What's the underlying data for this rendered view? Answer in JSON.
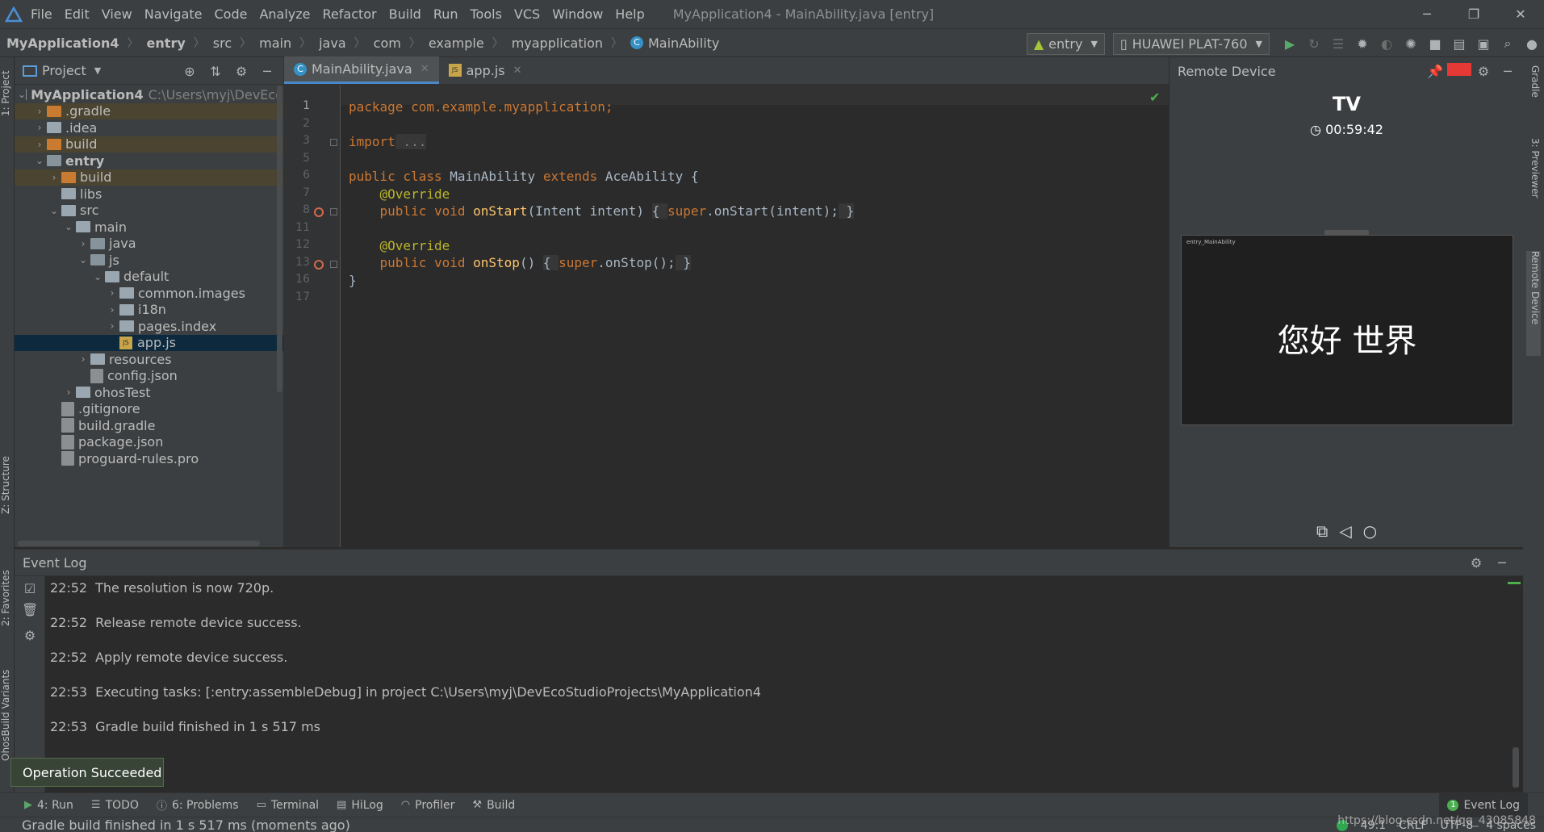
{
  "menubar": {
    "items": [
      "File",
      "Edit",
      "View",
      "Navigate",
      "Code",
      "Analyze",
      "Refactor",
      "Build",
      "Run",
      "Tools",
      "VCS",
      "Window",
      "Help"
    ],
    "window_title": "MyApplication4 - MainAbility.java [entry]"
  },
  "navbar": {
    "crumbs": [
      "MyApplication4",
      "entry",
      "src",
      "main",
      "java",
      "com",
      "example",
      "myapplication",
      "MainAbility"
    ],
    "run_config": "entry",
    "device": "HUAWEI PLAT-760"
  },
  "project": {
    "title": "Project",
    "root_path": "C:\\Users\\myj\\DevEco",
    "tree": [
      {
        "label": "MyApplication4",
        "depth": 0,
        "open": true,
        "kind": "module",
        "bold": true
      },
      {
        "label": ".gradle",
        "depth": 1,
        "open": false,
        "kind": "orange",
        "excluded": true
      },
      {
        "label": ".idea",
        "depth": 1,
        "open": false,
        "kind": "grey"
      },
      {
        "label": "build",
        "depth": 1,
        "open": false,
        "kind": "orange",
        "excluded": true
      },
      {
        "label": "entry",
        "depth": 1,
        "open": true,
        "kind": "module",
        "bold": true
      },
      {
        "label": "build",
        "depth": 2,
        "open": false,
        "kind": "orange",
        "excluded": true
      },
      {
        "label": "libs",
        "depth": 2,
        "open": null,
        "kind": "grey"
      },
      {
        "label": "src",
        "depth": 2,
        "open": true,
        "kind": "grey"
      },
      {
        "label": "main",
        "depth": 3,
        "open": true,
        "kind": "grey"
      },
      {
        "label": "java",
        "depth": 4,
        "open": false,
        "kind": "blue"
      },
      {
        "label": "js",
        "depth": 4,
        "open": true,
        "kind": "blue"
      },
      {
        "label": "default",
        "depth": 5,
        "open": true,
        "kind": "grey"
      },
      {
        "label": "common.images",
        "depth": 6,
        "open": false,
        "kind": "grey"
      },
      {
        "label": "i18n",
        "depth": 6,
        "open": false,
        "kind": "grey"
      },
      {
        "label": "pages.index",
        "depth": 6,
        "open": false,
        "kind": "grey"
      },
      {
        "label": "app.js",
        "depth": 6,
        "open": null,
        "kind": "js",
        "selected": true
      },
      {
        "label": "resources",
        "depth": 4,
        "open": false,
        "kind": "grey"
      },
      {
        "label": "config.json",
        "depth": 4,
        "open": null,
        "kind": "file"
      },
      {
        "label": "ohosTest",
        "depth": 3,
        "open": false,
        "kind": "grey"
      },
      {
        "label": ".gitignore",
        "depth": 2,
        "open": null,
        "kind": "file"
      },
      {
        "label": "build.gradle",
        "depth": 2,
        "open": null,
        "kind": "file"
      },
      {
        "label": "package.json",
        "depth": 2,
        "open": null,
        "kind": "file"
      },
      {
        "label": "proguard-rules.pro",
        "depth": 2,
        "open": null,
        "kind": "file"
      }
    ]
  },
  "editor": {
    "tabs": [
      {
        "label": "MainAbility.java",
        "active": true
      },
      {
        "label": "app.js",
        "active": false
      }
    ],
    "line_numbers": [
      "1",
      "2",
      "3",
      "5",
      "6",
      "7",
      "8",
      "11",
      "12",
      "13",
      "16",
      "17"
    ],
    "code": {
      "l1_kw": "package",
      "l1_rest": " com.example.myapplication;",
      "l3_kw": "import",
      "l3_rest": " ...",
      "l6_kw1": "public class",
      "l6_name": " MainAbility ",
      "l6_kw2": "extends",
      "l6_rest": " AceAbility {",
      "l7_ann": "    @Override",
      "l8_kw": "    public void",
      "l8_fn": " onStart",
      "l8_args": "(Intent intent) ",
      "l8_body_open": "{ ",
      "l8_super": "super",
      "l8_call": ".onStart(intent);",
      "l8_body_close": " }",
      "l12_ann": "    @Override",
      "l13_kw": "    public void",
      "l13_fn": " onStop",
      "l13_args": "() ",
      "l13_body_open": "{ ",
      "l13_super": "super",
      "l13_call": ".onStop();",
      "l13_body_close": " }",
      "l16": "}"
    }
  },
  "remote": {
    "title": "Remote Device",
    "device_name": "TV",
    "timer": "00:59:42",
    "screen_app": "entry_MainAbility",
    "screen_text": "您好 世界"
  },
  "eventlog": {
    "title": "Event Log",
    "entries": [
      {
        "time": "22:52",
        "text": "The resolution is now 720p."
      },
      {
        "time": "22:52",
        "text": "Release remote device success."
      },
      {
        "time": "22:52",
        "text": "Apply remote device success."
      },
      {
        "time": "22:53",
        "text": "Executing tasks: [:entry:assembleDebug] in project C:\\Users\\myj\\DevEcoStudioProjects\\MyApplication4"
      },
      {
        "time": "22:53",
        "text": "Gradle build finished in 1 s 517 ms"
      }
    ]
  },
  "tooltip": "Operation Succeeded",
  "stripes": {
    "left": [
      "1: Project",
      "Z: Structure",
      "2: Favorites",
      "OhosBuild Variants"
    ],
    "right": [
      "Gradle",
      "3: Previewer",
      "Remote Device"
    ]
  },
  "bottombar": {
    "items": [
      "4: Run",
      "TODO",
      "6: Problems",
      "Terminal",
      "HiLog",
      "Profiler",
      "Build"
    ],
    "event_log": "Event Log",
    "event_count": "1"
  },
  "statusbar": {
    "message": "Gradle build finished in 1 s 517 ms (moments ago)",
    "position": "49:1",
    "line_sep": "CRLF",
    "encoding": "UTF-8",
    "indent": "4 spaces",
    "watermark": "https://blog.csdn.net/qq_43085848"
  }
}
